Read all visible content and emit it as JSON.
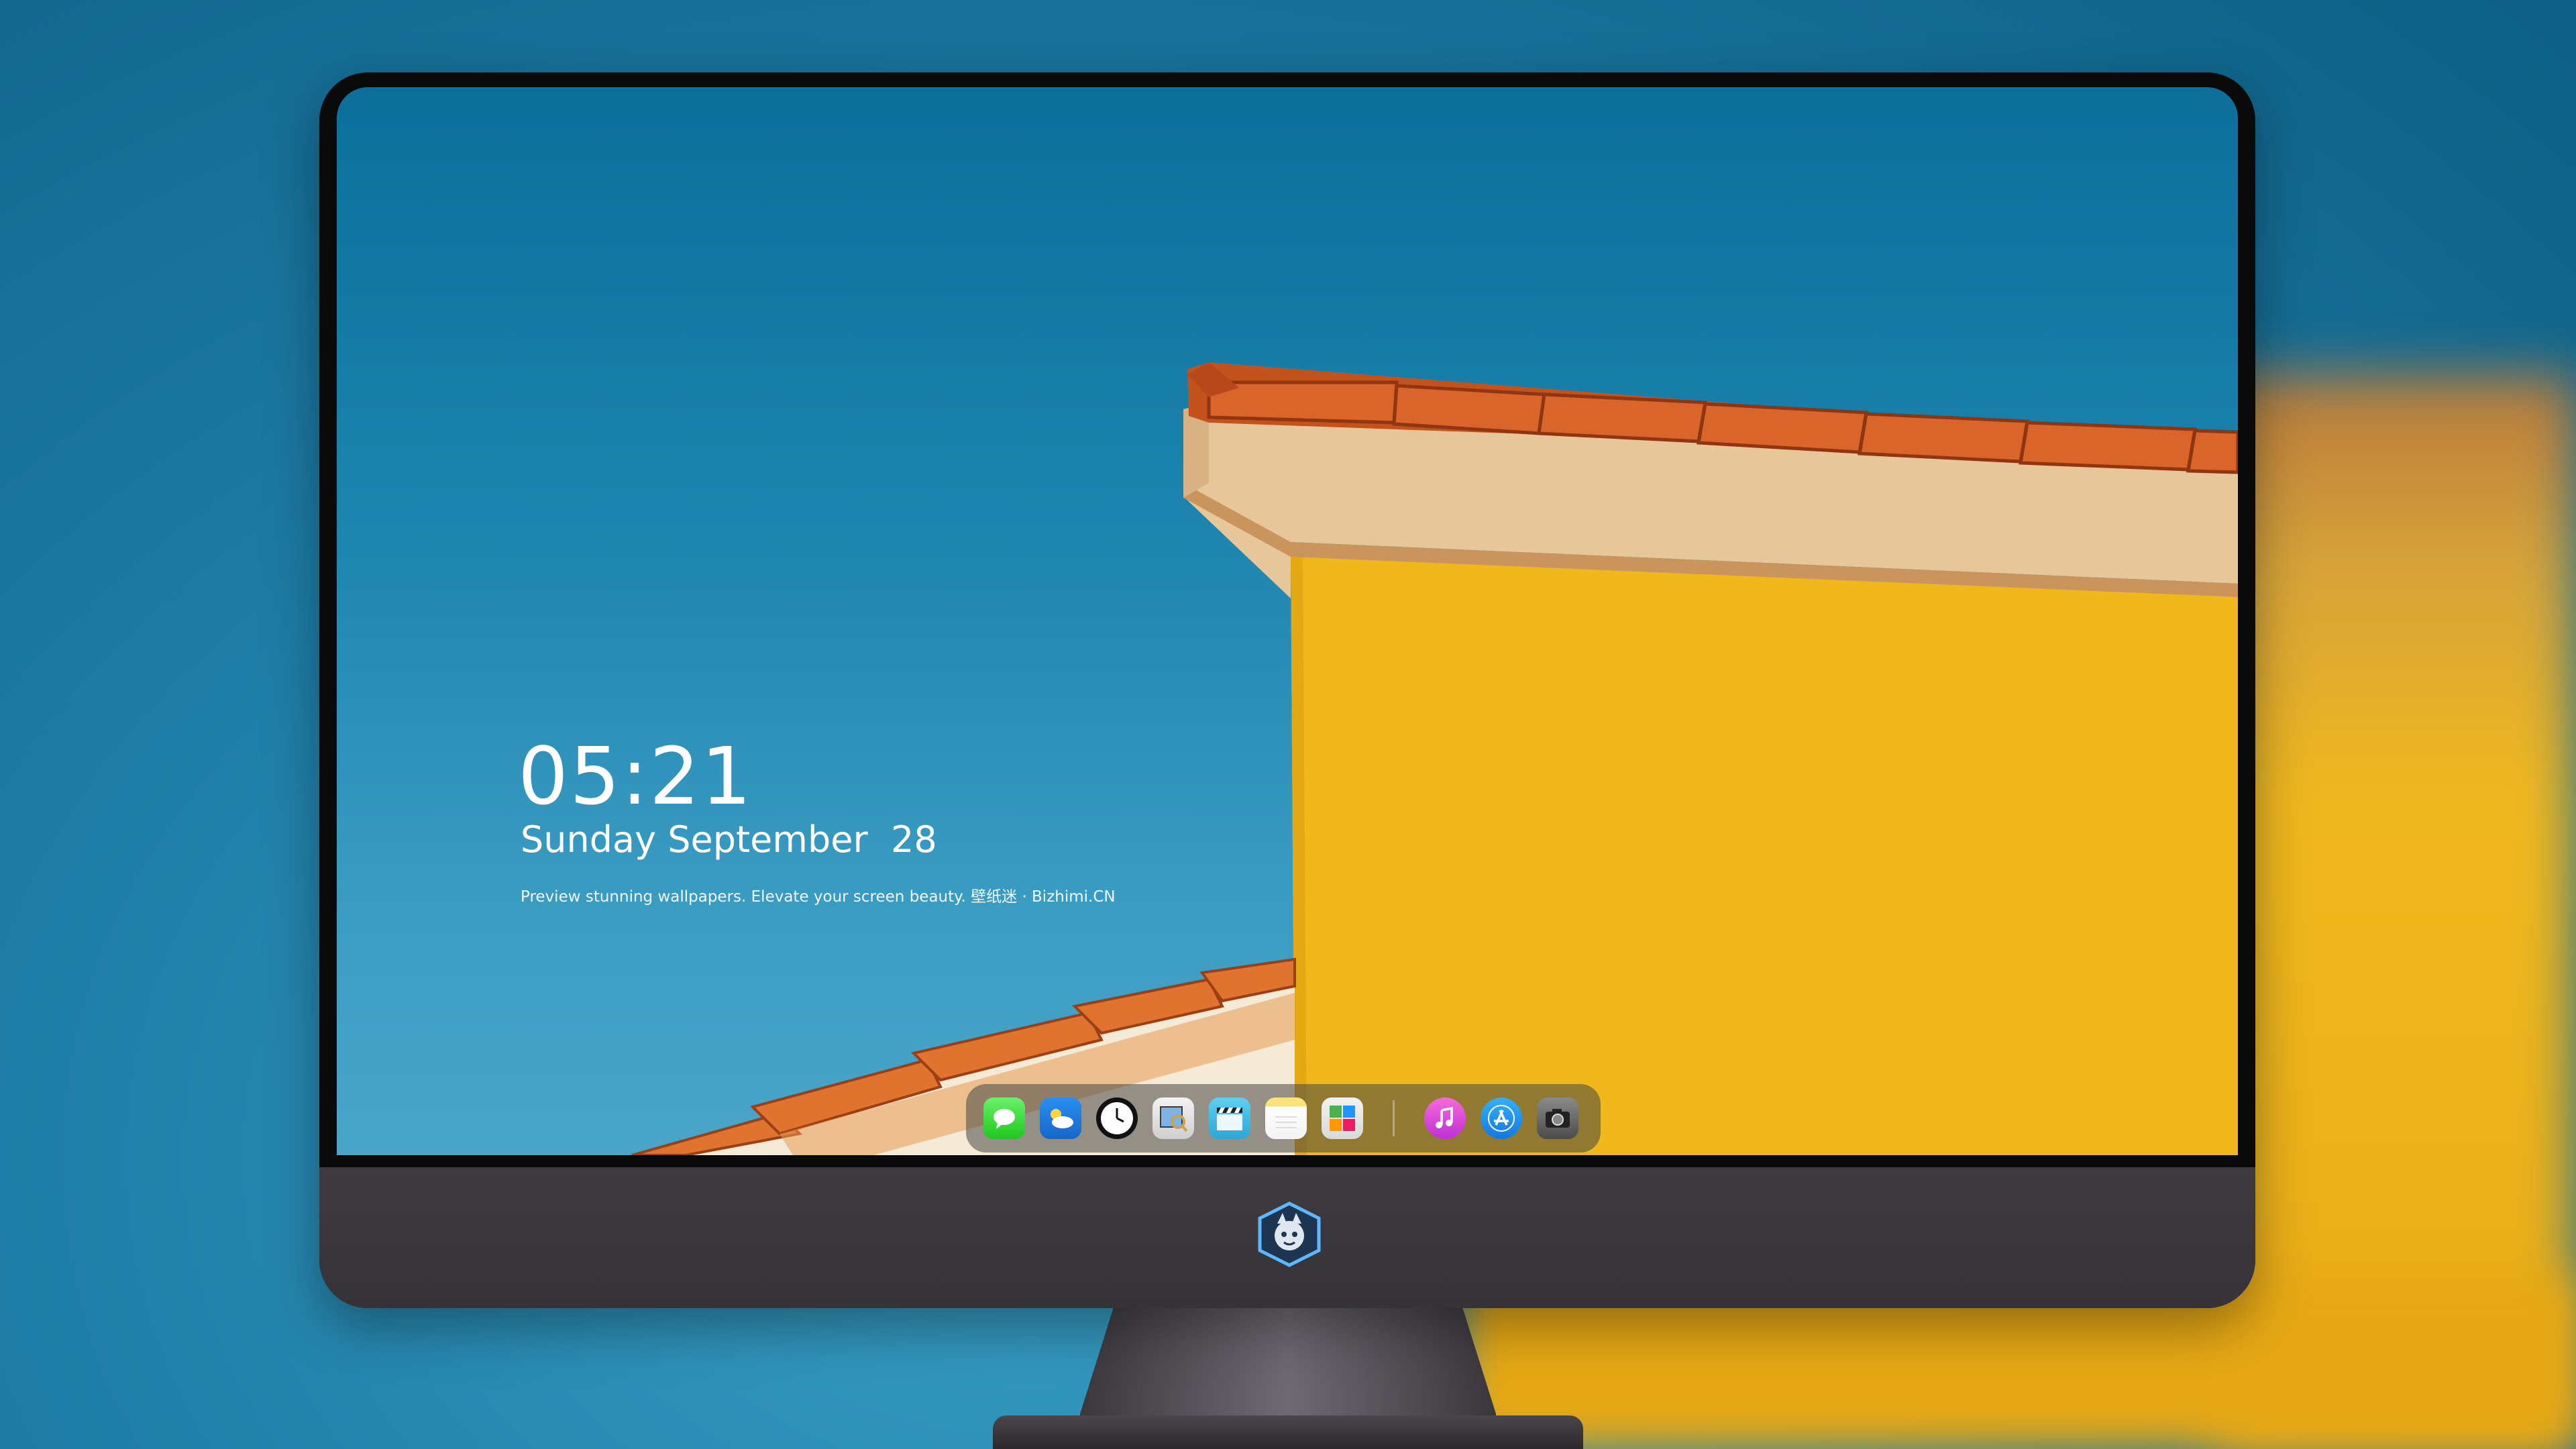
{
  "lockscreen": {
    "time": "05:21",
    "date": "Sunday September  28",
    "tagline": "Preview stunning wallpapers. Elevate your screen beauty. 壁纸迷 · Bizhimi.CN"
  },
  "dock": {
    "apps": [
      {
        "name": "Messages",
        "icon": "messages-icon"
      },
      {
        "name": "Weather",
        "icon": "weather-icon"
      },
      {
        "name": "Clock",
        "icon": "clock-icon"
      },
      {
        "name": "Preview",
        "icon": "preview-icon"
      },
      {
        "name": "Clips",
        "icon": "clapperboard-icon"
      },
      {
        "name": "Notes",
        "icon": "notes-icon"
      },
      {
        "name": "Photos",
        "icon": "photos-icon"
      },
      {
        "name": "Music",
        "icon": "music-icon"
      },
      {
        "name": "App Store",
        "icon": "app-store-icon"
      },
      {
        "name": "Camera",
        "icon": "camera-icon"
      }
    ]
  },
  "colors": {
    "sky": "#1c84ae",
    "wall": "#f0b81e",
    "roof_tile": "#c8541f",
    "bezel": "#0a0a0a",
    "chin": "#3e3b40"
  }
}
